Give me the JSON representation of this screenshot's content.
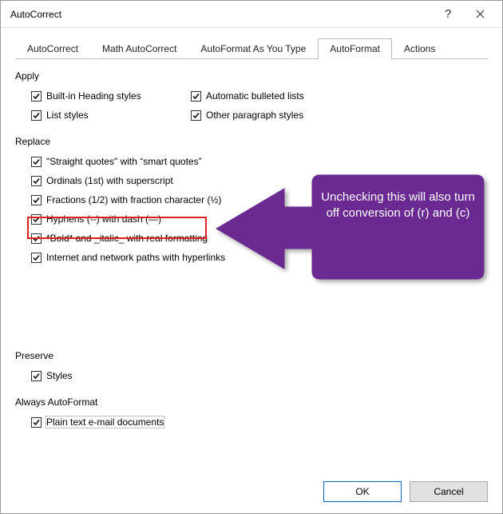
{
  "window": {
    "title": "AutoCorrect"
  },
  "tabs": {
    "t0": "AutoCorrect",
    "t1": "Math AutoCorrect",
    "t2": "AutoFormat As You Type",
    "t3": "AutoFormat",
    "t4": "Actions"
  },
  "sections": {
    "apply": "Apply",
    "replace": "Replace",
    "preserve": "Preserve",
    "always": "Always AutoFormat"
  },
  "apply": {
    "heading": "Built-in Heading styles",
    "bulleted": "Automatic bulleted lists",
    "list": "List styles",
    "other": "Other paragraph styles"
  },
  "replace": {
    "quotes": "\"Straight quotes\" with “smart quotes”",
    "ordinals": "Ordinals (1st) with superscript",
    "fractions": "Fractions (1/2) with fraction character (½)",
    "hyphens": "Hyphens (--) with dash (—)",
    "bold": "*Bold* and _italic_ with real formatting",
    "internet": "Internet and network paths with hyperlinks"
  },
  "preserve": {
    "styles": "Styles"
  },
  "always": {
    "plain": "Plain text e-mail documents"
  },
  "buttons": {
    "ok": "OK",
    "cancel": "Cancel"
  },
  "callout": {
    "text": "Unchecking this will also turn off conversion of (r) and (c)"
  }
}
